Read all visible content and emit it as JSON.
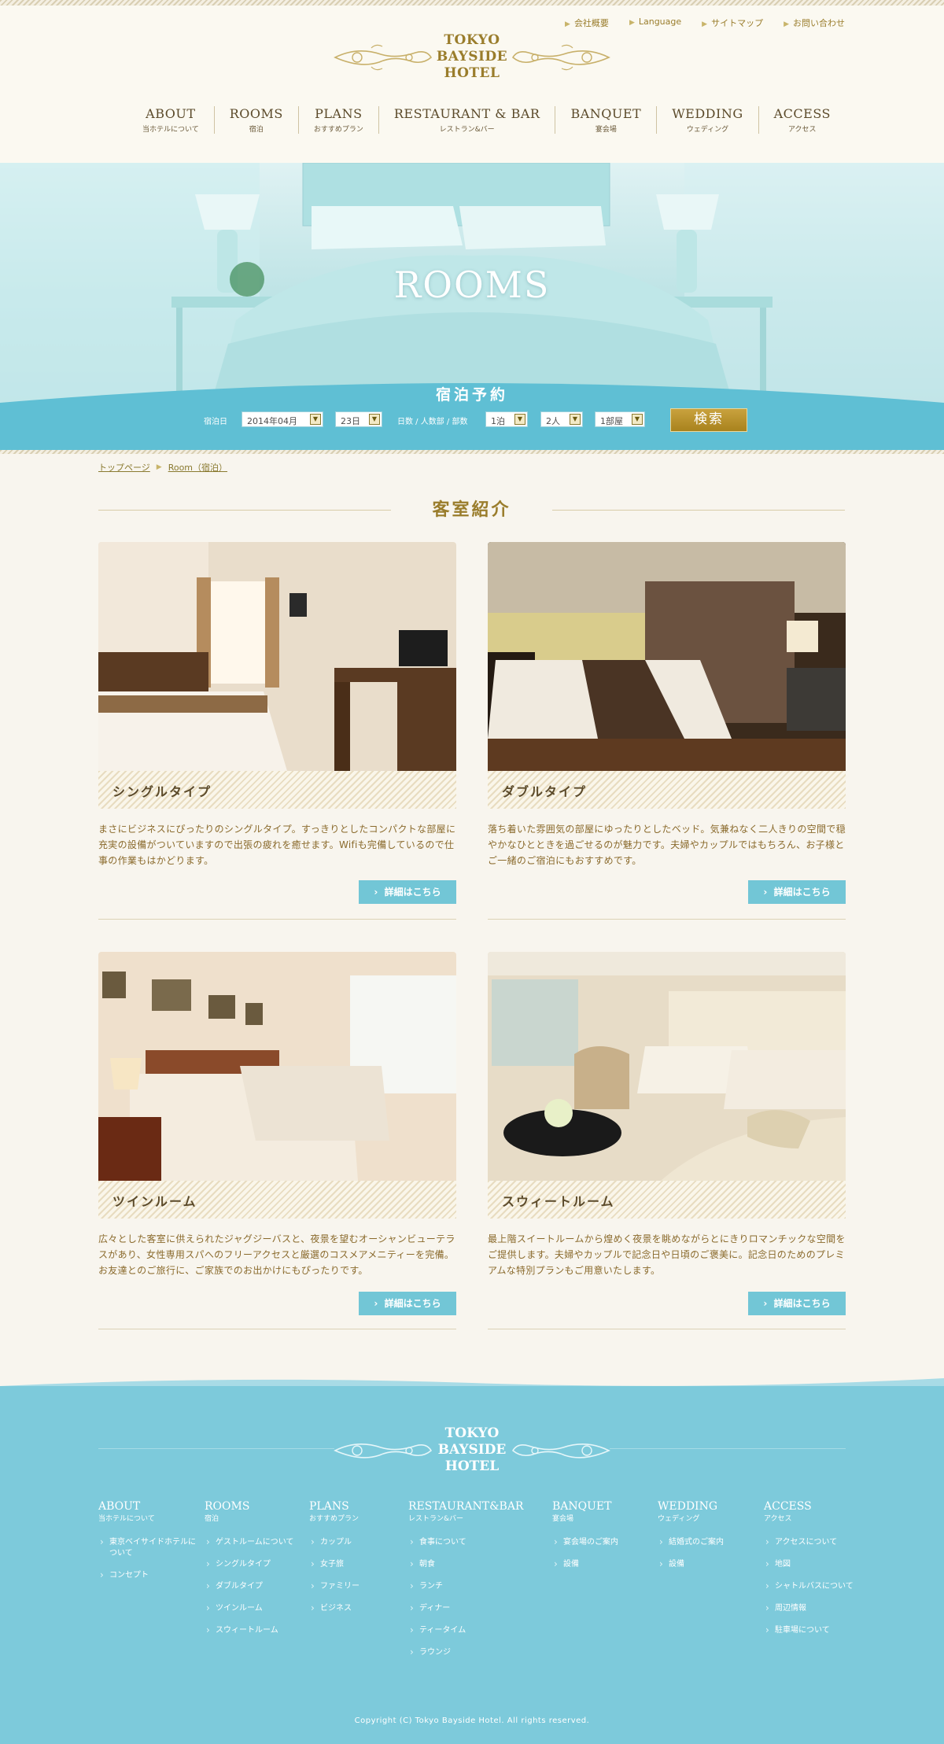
{
  "util_links": [
    "会社概要",
    "Language",
    "サイトマップ",
    "お問い合わせ"
  ],
  "brand": {
    "line1": "TOKYO",
    "line2": "BAYSIDE",
    "line3": "HOTEL"
  },
  "nav": [
    {
      "en": "ABOUT",
      "ja": "当ホテルについて"
    },
    {
      "en": "ROOMS",
      "ja": "宿泊"
    },
    {
      "en": "PLANS",
      "ja": "おすすめプラン"
    },
    {
      "en": "RESTAURANT & BAR",
      "ja": "レストラン&バー"
    },
    {
      "en": "BANQUET",
      "ja": "宴会場"
    },
    {
      "en": "WEDDING",
      "ja": "ウェディング"
    },
    {
      "en": "ACCESS",
      "ja": "アクセス"
    }
  ],
  "hero": {
    "title": "ROOMS"
  },
  "reservation": {
    "title": "宿泊予約",
    "date_label": "宿泊日",
    "month_value": "2014年04月",
    "day_value": "23日",
    "guests_label": "日数 / 人数部 / 部数",
    "nights_value": "1泊",
    "people_value": "2人",
    "rooms_value": "1部屋",
    "search_label": "検索"
  },
  "breadcrumb": {
    "home": "トップページ",
    "current": "Room（宿泊）"
  },
  "section": {
    "title": "客室紹介"
  },
  "rooms": [
    {
      "name": "シングルタイプ",
      "desc": "まさにビジネスにぴったりのシングルタイプ。すっきりとしたコンパクトな部屋に充実の設備がついていますので出張の疲れを癒せます。Wifiも完備しているので仕事の作業もはかどります。",
      "more": "詳細はこちら"
    },
    {
      "name": "ダブルタイプ",
      "desc": "落ち着いた雰囲気の部屋にゆったりとしたベッド。気兼ねなく二人きりの空間で穏やかなひとときを過ごせるのが魅力です。夫婦やカップルではもちろん、お子様とご一緒のご宿泊にもおすすめです。",
      "more": "詳細はこちら"
    },
    {
      "name": "ツインルーム",
      "desc": "広々とした客室に供えられたジャグジーバスと、夜景を望むオーシャンビューテラスがあり、女性専用スパへのフリーアクセスと厳選のコスメアメニティーを完備。お友達とのご旅行に、ご家族でのお出かけにもぴったりです。",
      "more": "詳細はこちら"
    },
    {
      "name": "スウィートルーム",
      "desc": "最上階スイートルームから煌めく夜景を眺めながらとにきりロマンチックな空間をご提供します。夫婦やカップルで記念日や日頃のご褒美に。記念日のためのプレミアムな特別プランもご用意いたします。",
      "more": "詳細はこちら"
    }
  ],
  "footer": {
    "columns": [
      {
        "en": "ABOUT",
        "ja": "当ホテルについて",
        "items": [
          "東京ベイサイドホテルについて",
          "コンセプト"
        ]
      },
      {
        "en": "ROOMS",
        "ja": "宿泊",
        "items": [
          "ゲストルームについて",
          "シングルタイプ",
          "ダブルタイプ",
          "ツインルーム",
          "スウィートルーム"
        ]
      },
      {
        "en": "PLANS",
        "ja": "おすすめプラン",
        "items": [
          "カップル",
          "女子旅",
          "ファミリー",
          "ビジネス"
        ]
      },
      {
        "en": "RESTAURANT&BAR",
        "ja": "レストラン&バー",
        "items": [
          "食事について",
          "朝食",
          "ランチ",
          "ディナー",
          "ティータイム",
          "ラウンジ"
        ]
      },
      {
        "en": "BANQUET",
        "ja": "宴会場",
        "items": [
          "宴会場のご案内",
          "設備"
        ]
      },
      {
        "en": "WEDDING",
        "ja": "ウェディング",
        "items": [
          "結婚式のご案内",
          "設備"
        ]
      },
      {
        "en": "ACCESS",
        "ja": "アクセス",
        "items": [
          "アクセスについて",
          "地図",
          "シャトルバスについて",
          "周辺情報",
          "駐車場について"
        ]
      }
    ],
    "copyright": "Copyright (C) Tokyo Bayside Hotel. All rights reserved."
  },
  "colors": {
    "gold": "#9a7d2c",
    "aqua": "#72c6d6",
    "footer": "#7dcadb",
    "cream": "#f8f5ee"
  }
}
